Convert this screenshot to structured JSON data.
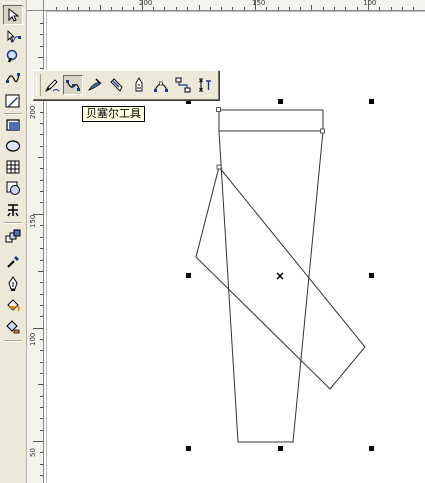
{
  "rulers": {
    "horizontal_labels": [
      "200",
      "150",
      "100"
    ],
    "vertical_labels": [
      "200",
      "150",
      "100",
      "50"
    ]
  },
  "toolbox": {
    "tools": [
      {
        "name": "pick-tool",
        "icon": "arrow-pointer-icon"
      },
      {
        "name": "shape-tool",
        "icon": "shape-node-icon"
      },
      {
        "name": "zoom-tool",
        "icon": "magnifier-icon"
      },
      {
        "name": "curve-tool",
        "icon": "bezier-curve-icon"
      },
      {
        "name": "smart-tool",
        "icon": "smart-drawing-icon"
      },
      {
        "name": "rectangle-tool",
        "icon": "rectangle-icon"
      },
      {
        "name": "ellipse-tool",
        "icon": "ellipse-icon"
      },
      {
        "name": "graph-paper-tool",
        "icon": "grid-icon"
      },
      {
        "name": "basic-shapes-tool",
        "icon": "basic-shapes-icon"
      },
      {
        "name": "text-tool",
        "icon": "text-icon"
      },
      {
        "name": "interactive-blend-tool",
        "icon": "blend-icon"
      },
      {
        "name": "eyedropper-tool",
        "icon": "eyedropper-icon"
      },
      {
        "name": "outline-tool",
        "icon": "pen-nib-icon"
      },
      {
        "name": "fill-tool",
        "icon": "paint-bucket-icon"
      },
      {
        "name": "interactive-fill-tool",
        "icon": "interactive-fill-icon"
      }
    ]
  },
  "flyout": {
    "tools": [
      {
        "name": "freehand-tool",
        "icon": "freehand-pencil-icon"
      },
      {
        "name": "bezier-tool",
        "icon": "bezier-pen-icon",
        "active": true
      },
      {
        "name": "artistic-media-tool",
        "icon": "artistic-media-icon"
      },
      {
        "name": "pen-tool",
        "icon": "pen-icon"
      },
      {
        "name": "polyline-tool",
        "icon": "polyline-icon"
      },
      {
        "name": "three-point-curve-tool",
        "icon": "three-point-curve-icon"
      },
      {
        "name": "interactive-connector-tool",
        "icon": "connector-icon"
      },
      {
        "name": "dimension-tool",
        "icon": "dimension-icon"
      }
    ]
  },
  "tooltip": {
    "text": "贝塞尔工具"
  },
  "colors": {
    "toolbar_bg": "#ece9d8",
    "tooltip_bg": "#ffffe1",
    "shape_stroke": "#333333"
  }
}
